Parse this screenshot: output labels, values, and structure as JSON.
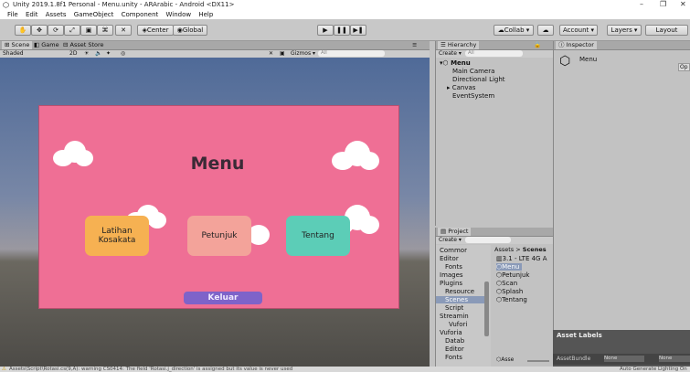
{
  "window": {
    "title": "Unity 2019.1.8f1 Personal - Menu.unity - ARArabic - Android <DX11>",
    "controls": [
      "–",
      "❐",
      "✕"
    ]
  },
  "menubar": [
    "File",
    "Edit",
    "Assets",
    "GameObject",
    "Component",
    "Window",
    "Help"
  ],
  "toolbar": {
    "center": "Center",
    "global": "Global",
    "collab": "Collab ▾",
    "account": "Account ▾",
    "layers": "Layers ▾",
    "layout": "Layout"
  },
  "scene": {
    "tabs": [
      "Scene",
      "Game",
      "Asset Store"
    ],
    "shading": "Shaded",
    "mode2d": "2D",
    "gizmos": "Gizmos ▾",
    "search": "All"
  },
  "game_canvas": {
    "title": "Menu",
    "buttons": [
      "Latihan Kosakata",
      "Petunjuk",
      "Tentang"
    ],
    "exit": "Keluar",
    "colors": {
      "bg": "#ef6f95",
      "latihan": "#f6b152",
      "petunjuk": "#f3a39a",
      "tentang": "#5ccdb7",
      "keluar": "#7e63c9"
    }
  },
  "hierarchy": {
    "tab": "Hierarchy",
    "create": "Create ▾",
    "search": "All",
    "scene_name": "Menu",
    "items": [
      "Main Camera",
      "Directional Light",
      "Canvas",
      "EventSystem"
    ]
  },
  "inspector": {
    "tab": "Inspector",
    "object_name": "Menu",
    "open_btn": "Op"
  },
  "project": {
    "tab": "Project",
    "create": "Create ▾",
    "tree": [
      "Commor",
      "Editor",
      "Fonts",
      "Images",
      "Plugins",
      "Resource",
      "Scenes",
      "Script",
      "Streamin",
      "Vufori",
      "Vuforia",
      "Datab",
      "Editor",
      "Fonts"
    ],
    "breadcrumb_root": "Assets",
    "breadcrumb_sep": ">",
    "breadcrumb_leaf": "Scenes",
    "assets": [
      "3.1 - LTE 4G A",
      "Menu",
      "Petunjuk",
      "Scan",
      "Splash",
      "Tentang"
    ],
    "footer_label": "Asse"
  },
  "asset_labels": {
    "title": "Asset Labels",
    "bundle": "AssetBundle",
    "none1": "None",
    "none2": "None"
  },
  "status": {
    "warning": "Assets\\Script\\Rotasi.cs(9,A): warning CS0414: The field 'Rotasi.j_direction' is assigned but its value is never used",
    "right": "Auto Generate Lighting On"
  }
}
